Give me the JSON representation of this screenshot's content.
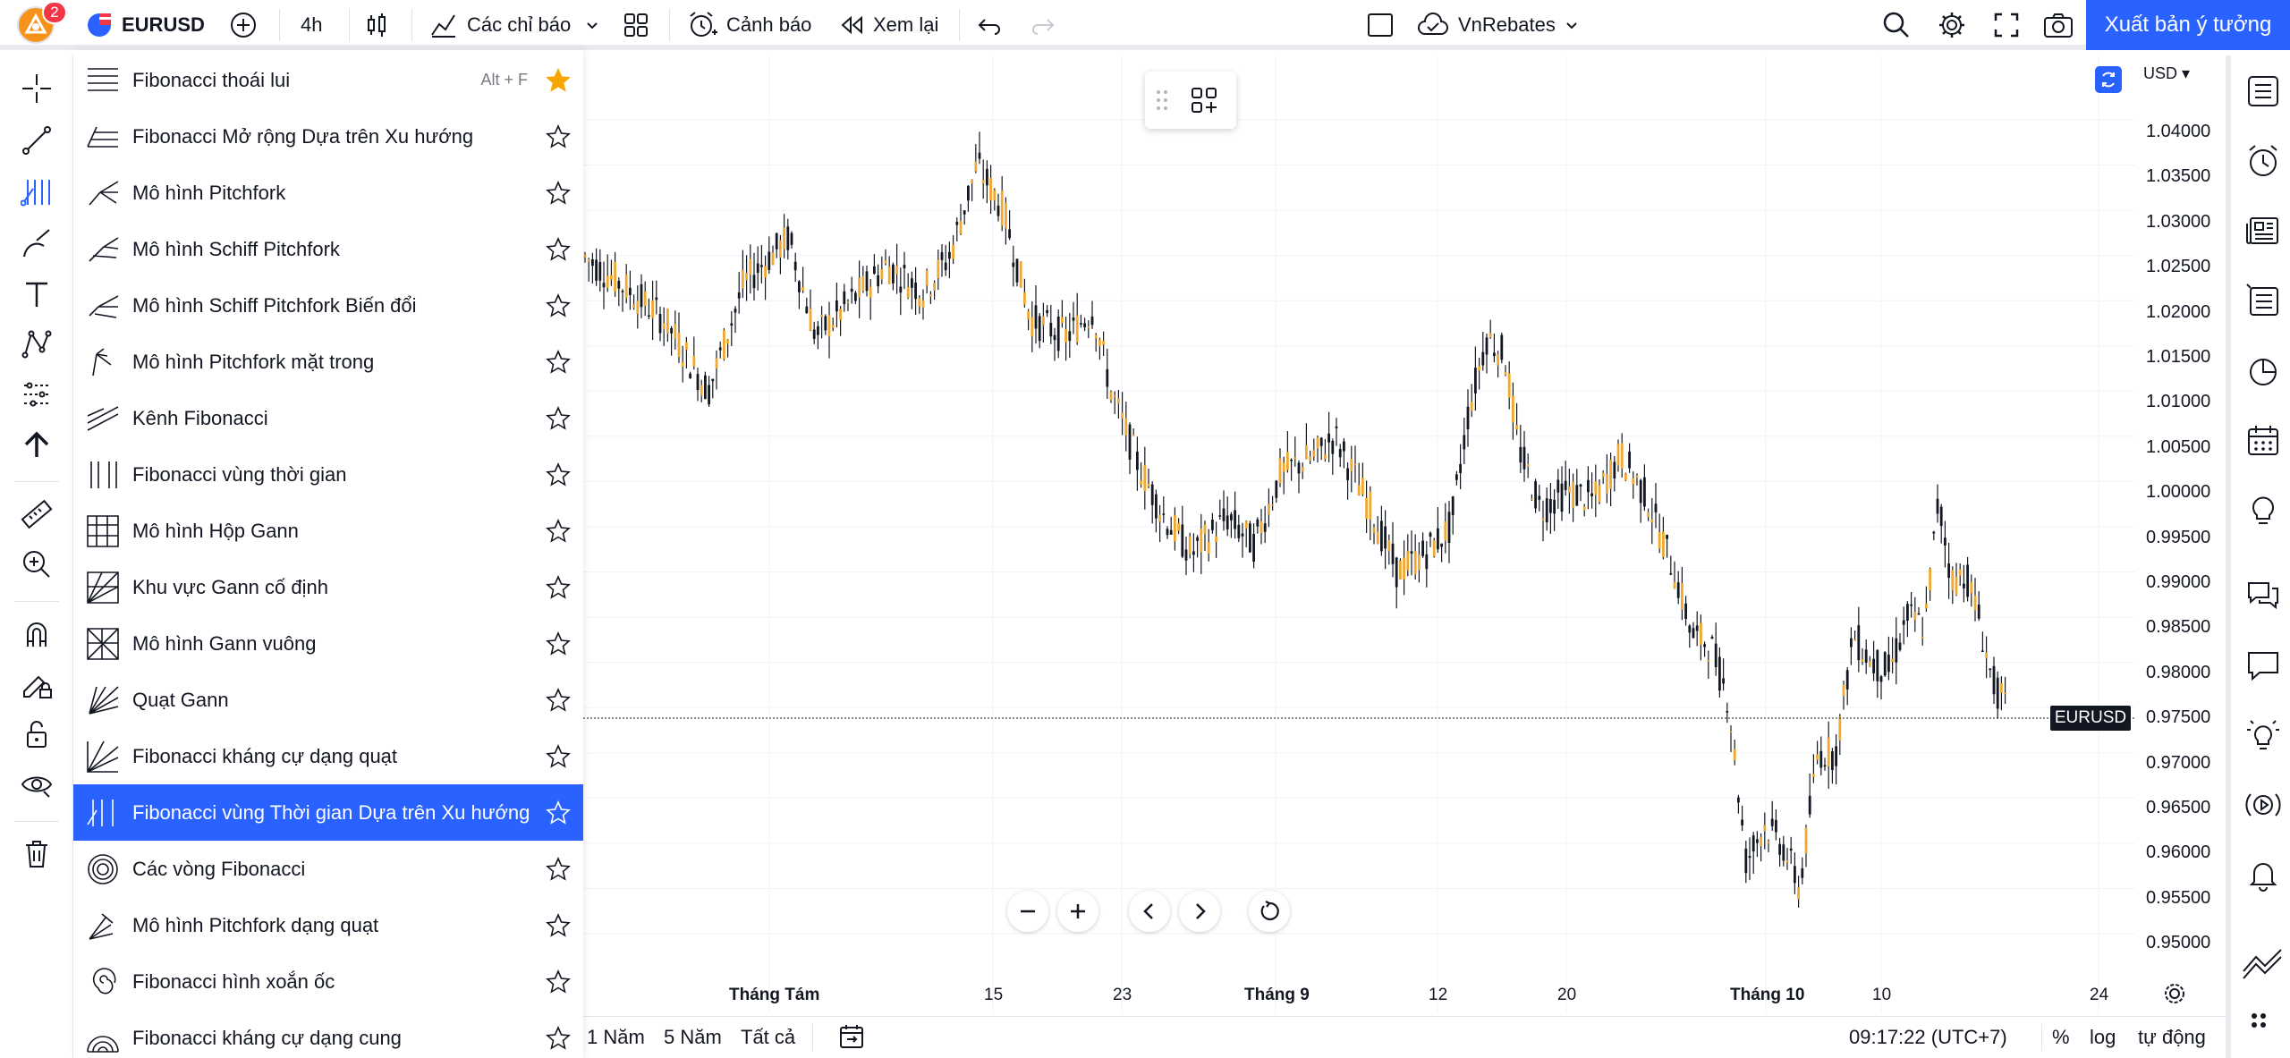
{
  "toolbar": {
    "badge_count": "2",
    "symbol": "EURUSD",
    "interval": "4h",
    "indicators_label": "Các chỉ báo",
    "alerts_label": "Cảnh báo",
    "replay_label": "Xem lại",
    "account_label": "VnRebates",
    "publish_label": "Xuất bản ý tưởng"
  },
  "menu": {
    "items": [
      {
        "label": "Fibonacci thoái lui",
        "shortcut": "Alt + F",
        "favorite": true,
        "active": false
      },
      {
        "label": "Fibonacci Mở rộng Dựa trên Xu hướng",
        "shortcut": "",
        "favorite": false,
        "active": false
      },
      {
        "label": "Mô hình Pitchfork",
        "shortcut": "",
        "favorite": false,
        "active": false
      },
      {
        "label": "Mô hình Schiff Pitchfork",
        "shortcut": "",
        "favorite": false,
        "active": false
      },
      {
        "label": "Mô hình Schiff Pitchfork Biến đổi",
        "shortcut": "",
        "favorite": false,
        "active": false
      },
      {
        "label": "Mô hình Pitchfork mặt trong",
        "shortcut": "",
        "favorite": false,
        "active": false
      },
      {
        "label": "Kênh Fibonacci",
        "shortcut": "",
        "favorite": false,
        "active": false
      },
      {
        "label": "Fibonacci vùng thời gian",
        "shortcut": "",
        "favorite": false,
        "active": false
      },
      {
        "label": "Mô hình Hộp Gann",
        "shortcut": "",
        "favorite": false,
        "active": false
      },
      {
        "label": "Khu vực Gann cố định",
        "shortcut": "",
        "favorite": false,
        "active": false
      },
      {
        "label": "Mô hình Gann vuông",
        "shortcut": "",
        "favorite": false,
        "active": false
      },
      {
        "label": "Quạt Gann",
        "shortcut": "",
        "favorite": false,
        "active": false
      },
      {
        "label": "Fibonacci kháng cự dạng quạt",
        "shortcut": "",
        "favorite": false,
        "active": false
      },
      {
        "label": "Fibonacci vùng Thời gian Dựa trên Xu hướng",
        "shortcut": "",
        "favorite": false,
        "active": true
      },
      {
        "label": "Các vòng Fibonacci",
        "shortcut": "",
        "favorite": false,
        "active": false
      },
      {
        "label": "Mô hình Pitchfork dạng quạt",
        "shortcut": "",
        "favorite": false,
        "active": false
      },
      {
        "label": "Fibonacci hình xoắn ốc",
        "shortcut": "",
        "favorite": false,
        "active": false
      },
      {
        "label": "Fibonacci kháng cự dạng cung",
        "shortcut": "",
        "favorite": false,
        "active": false
      }
    ]
  },
  "price_axis": {
    "currency": "USD",
    "labels": [
      "1.04000",
      "1.03500",
      "1.03000",
      "1.02500",
      "1.02000",
      "1.01500",
      "1.01000",
      "1.00500",
      "1.00000",
      "0.99500",
      "0.99000",
      "0.98500",
      "0.98000",
      "0.97500",
      "0.97000",
      "0.96500",
      "0.96000",
      "0.95500",
      "0.95000"
    ],
    "symbol_tag": "EURUSD"
  },
  "time_axis": {
    "labels": [
      {
        "text": "Tháng Tám",
        "bold": true
      },
      {
        "text": "15",
        "bold": false
      },
      {
        "text": "23",
        "bold": false
      },
      {
        "text": "Tháng 9",
        "bold": true
      },
      {
        "text": "12",
        "bold": false
      },
      {
        "text": "20",
        "bold": false
      },
      {
        "text": "Tháng 10",
        "bold": true
      },
      {
        "text": "10",
        "bold": false
      },
      {
        "text": "24",
        "bold": false
      }
    ]
  },
  "bottombar": {
    "range_1y": "1 Năm",
    "range_5y": "5 Năm",
    "range_all": "Tất cả",
    "clock": "09:17:22 (UTC+7)",
    "percent": "%",
    "log": "log",
    "auto": "tự động"
  },
  "colors": {
    "accent": "#2962ff",
    "up_candle": "#f0a830",
    "down_candle": "#131722"
  }
}
